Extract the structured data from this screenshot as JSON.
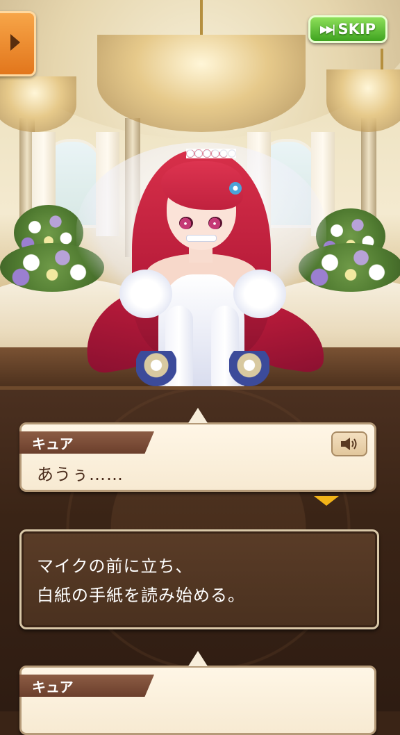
{
  "controls": {
    "skip_label": "SKIP",
    "skip_icon": "fast-forward-icon",
    "menu_icon": "play-triangle-icon"
  },
  "log": [
    {
      "type": "speech",
      "speaker": "キュア",
      "text": "あうぅ……",
      "voice_icon": "speaker-icon"
    },
    {
      "type": "narration",
      "lines": [
        "マイクの前に立ち、",
        "白紙の手紙を読み始める。"
      ]
    },
    {
      "type": "speech",
      "speaker": "キュア",
      "text": ""
    }
  ],
  "colors": {
    "skip_button": "#4caf2a",
    "menu_button": "#ec8a2a",
    "next_indicator": "#f2b318",
    "name_tag": "#7a4b36"
  }
}
